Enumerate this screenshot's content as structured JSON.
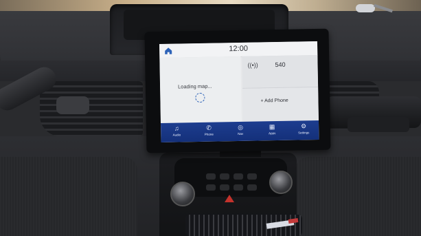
{
  "screen": {
    "clock": "12:00",
    "map": {
      "loading_text": "Loading map..."
    },
    "radio": {
      "icon": "radio-signal-icon",
      "frequency": "540"
    },
    "phone": {
      "add_label": "+   Add Phone"
    },
    "nav": [
      {
        "label": "Audio",
        "icon": "music-note-icon",
        "glyph": "♫"
      },
      {
        "label": "Phone",
        "icon": "phone-icon",
        "glyph": "✆"
      },
      {
        "label": "Nav",
        "icon": "navigation-icon",
        "glyph": "◎"
      },
      {
        "label": "Apps",
        "icon": "apps-grid-icon",
        "glyph": "▦"
      },
      {
        "label": "Settings",
        "icon": "settings-icon",
        "glyph": "⚙"
      }
    ]
  },
  "colors": {
    "nav_bar": "#1d3d8f",
    "screen_background": "#e7e8ea",
    "hazard_button": "#c4322c"
  }
}
